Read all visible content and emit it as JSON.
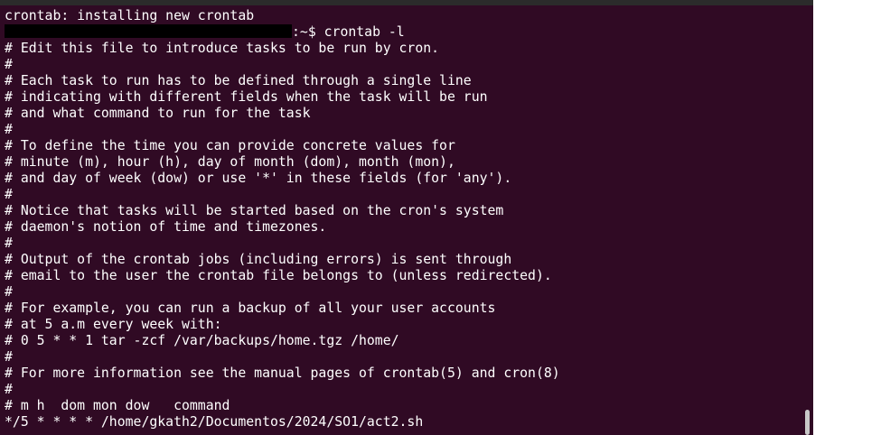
{
  "terminal": {
    "prompt_suffix": ":~$ crontab -l",
    "lines": [
      "crontab: installing new crontab",
      "",
      "# Edit this file to introduce tasks to be run by cron.",
      "#",
      "# Each task to run has to be defined through a single line",
      "# indicating with different fields when the task will be run",
      "# and what command to run for the task",
      "#",
      "# To define the time you can provide concrete values for",
      "# minute (m), hour (h), day of month (dom), month (mon),",
      "# and day of week (dow) or use '*' in these fields (for 'any').",
      "#",
      "# Notice that tasks will be started based on the cron's system",
      "# daemon's notion of time and timezones.",
      "#",
      "# Output of the crontab jobs (including errors) is sent through",
      "# email to the user the crontab file belongs to (unless redirected).",
      "#",
      "# For example, you can run a backup of all your user accounts",
      "# at 5 a.m every week with:",
      "# 0 5 * * 1 tar -zcf /var/backups/home.tgz /home/",
      "#",
      "# For more information see the manual pages of crontab(5) and cron(8)",
      "#",
      "# m h  dom mon dow   command",
      "*/5 * * * * /home/gkath2/Documentos/2024/SO1/act2.sh"
    ]
  },
  "colors": {
    "terminal_background": "#300a24",
    "text": "#ffffff"
  }
}
